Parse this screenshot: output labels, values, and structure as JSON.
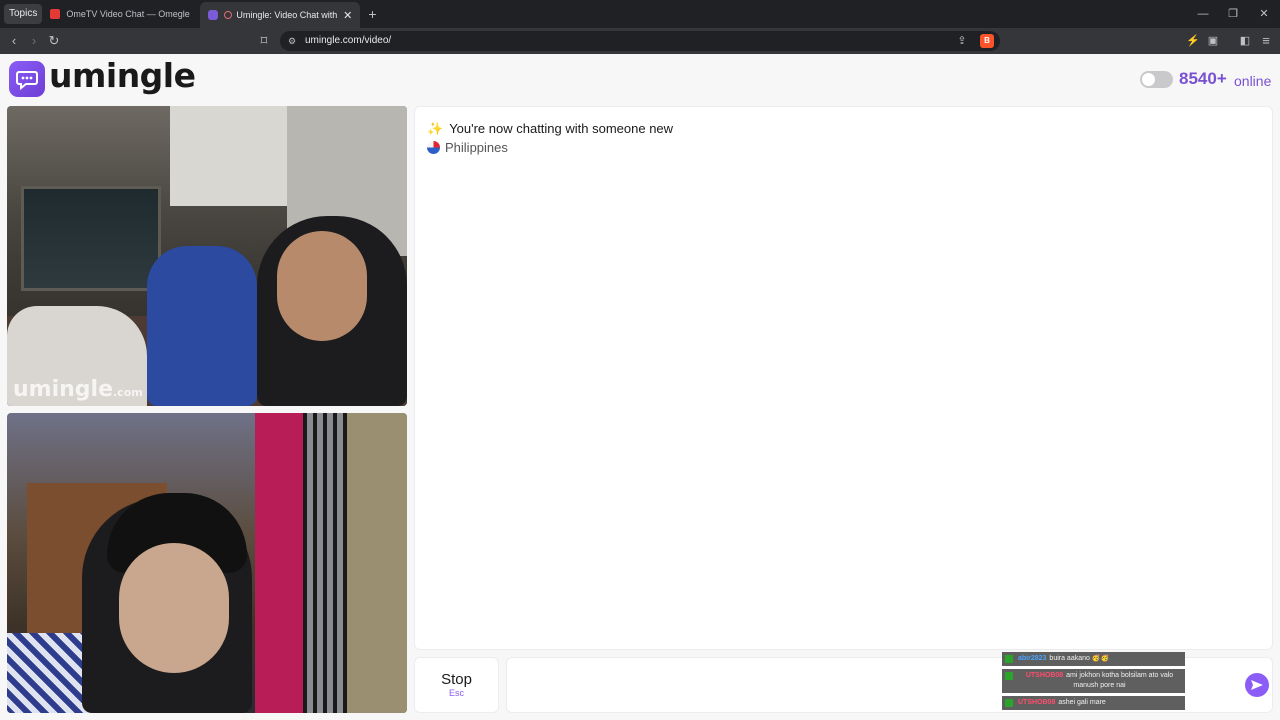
{
  "browser": {
    "topics_label": "Topics",
    "tabs": [
      {
        "title": "OmeTV Video Chat — Omegle Random",
        "active": false
      },
      {
        "title": "Umingle: Video Chat with Strangers",
        "active": true
      }
    ],
    "new_tab": "+",
    "url": "umingle.com/video/",
    "window_controls": {
      "minimize": "—",
      "maximize": "❐",
      "close": "✕"
    }
  },
  "header": {
    "brand": "umingle",
    "online_count": "8540+",
    "online_label": "online"
  },
  "videos": {
    "remote_watermark": "umingle",
    "remote_watermark_suffix": ".com"
  },
  "chat": {
    "status_text": "You're now chatting with someone new",
    "country": "Philippines"
  },
  "controls": {
    "stop_label": "Stop",
    "stop_key": "Esc",
    "message_placeholder": ""
  },
  "stream_overlay": [
    {
      "name": "abir2823",
      "message": "buira aakano 🥳🥳"
    },
    {
      "name": "UTSHOB08",
      "message": "ami jokhon kotha bolsilam ato valo manush pore nai"
    },
    {
      "name": "UTSHOB08",
      "message": "ashei gali mare"
    }
  ],
  "colors": {
    "accent": "#8b5cf6",
    "online_text": "#7a52d1",
    "browser_dark": "#202124"
  }
}
